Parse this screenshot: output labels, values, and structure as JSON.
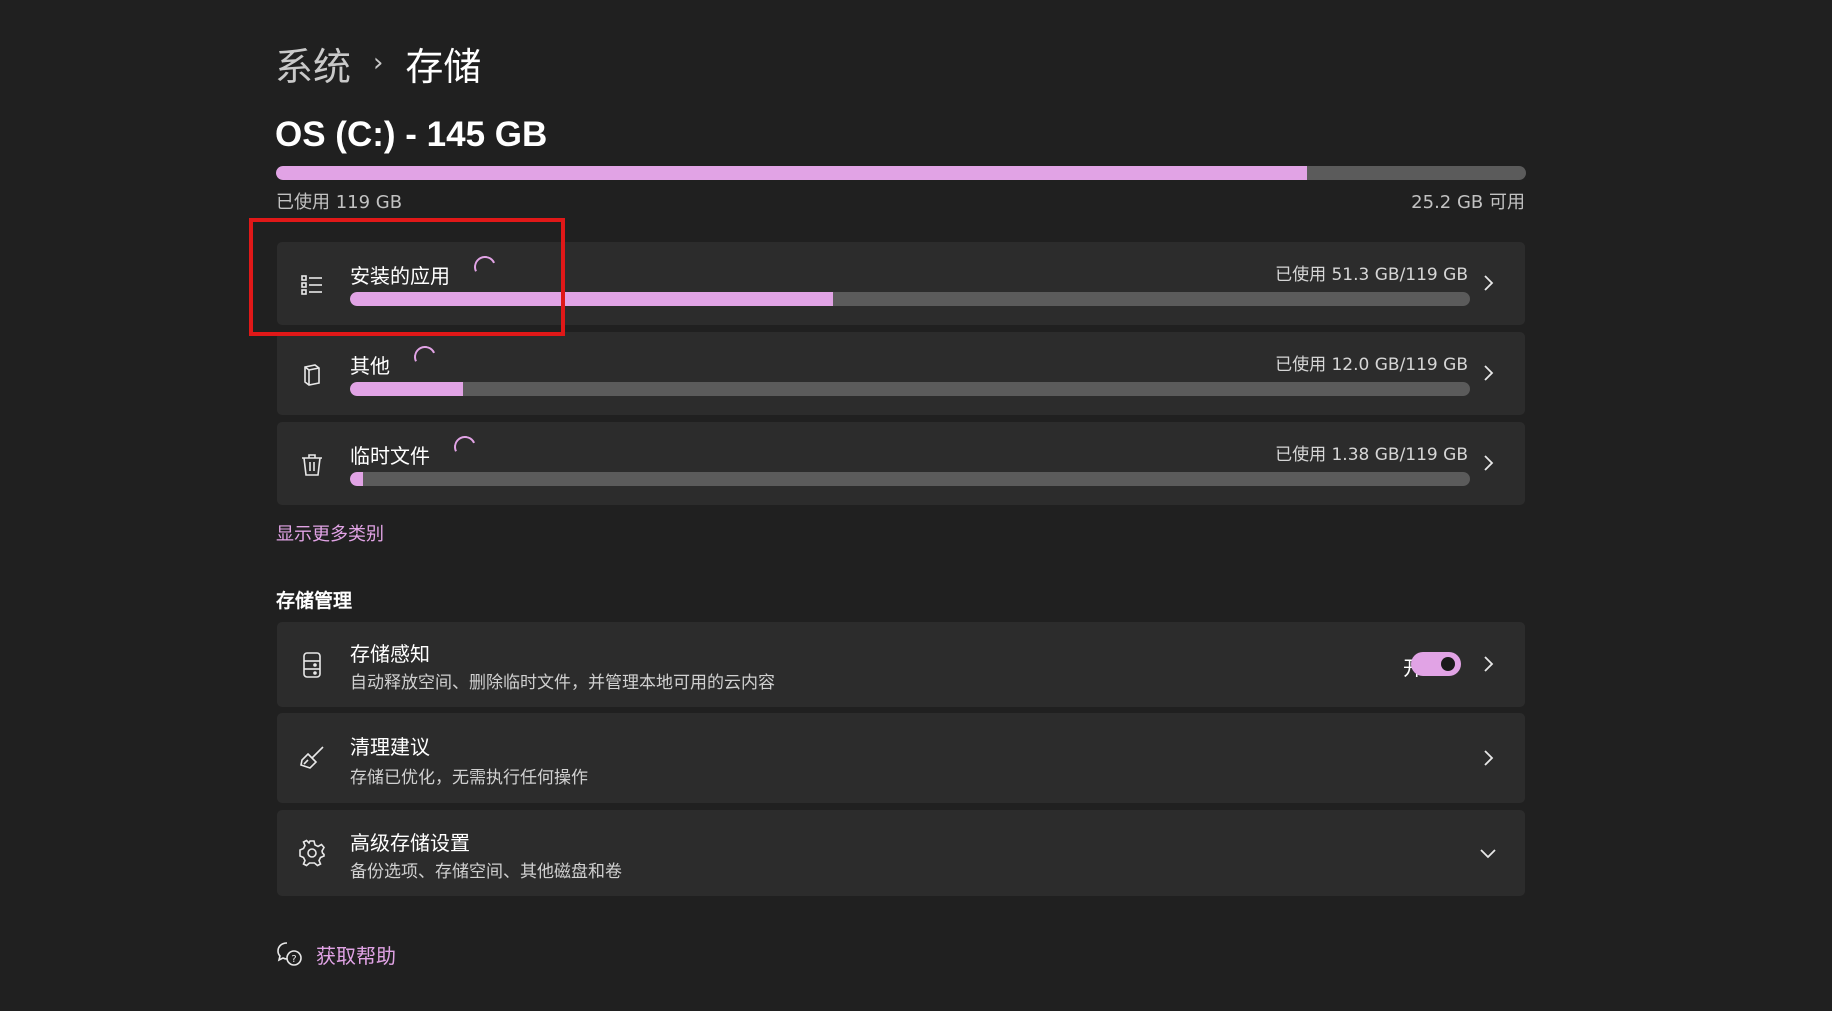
{
  "breadcrumb": {
    "parent": "系统",
    "separator": "›",
    "current": "存储"
  },
  "drive": {
    "title": "OS (C:) - 145 GB",
    "used_label": "已使用 119 GB",
    "free_label": "25.2 GB 可用",
    "used_fraction": 0.825
  },
  "categories": [
    {
      "label": "安装的应用",
      "usage": "已使用 51.3 GB/119 GB",
      "fraction": 0.431,
      "icon": "list-icon"
    },
    {
      "label": "其他",
      "usage": "已使用 12.0 GB/119 GB",
      "fraction": 0.101,
      "icon": "files-icon"
    },
    {
      "label": "临时文件",
      "usage": "已使用 1.38 GB/119 GB",
      "fraction": 0.0116,
      "icon": "trash-icon"
    }
  ],
  "show_more_link": "显示更多类别",
  "storage_management": {
    "heading": "存储管理",
    "storage_sense": {
      "title": "存储感知",
      "description": "自动释放空间、删除临时文件，并管理本地可用的云内容",
      "toggle_label": "开",
      "toggle_on": true
    },
    "cleanup": {
      "title": "清理建议",
      "description": "存储已优化，无需执行任何操作"
    },
    "advanced": {
      "title": "高级存储设置",
      "description": "备份选项、存储空间、其他磁盘和卷"
    }
  },
  "help_link": "获取帮助",
  "colors": {
    "background": "#202020",
    "card": "#2c2c2c",
    "accent": "#e1a3e5",
    "track": "#5b5b5b",
    "highlight": "#e01818"
  }
}
